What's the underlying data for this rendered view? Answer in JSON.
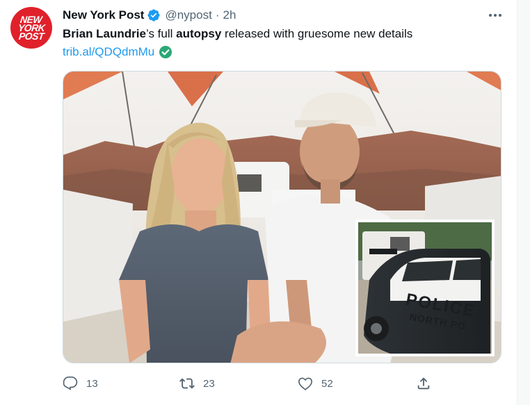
{
  "tweet": {
    "author_name": "New York Post",
    "handle": "@nypost",
    "separator": "·",
    "time": "2h",
    "avatar_lines": [
      "NEW",
      "YORK",
      "POST"
    ],
    "text_segments": [
      {
        "text": "Brian Laundrie",
        "bold": true
      },
      {
        "text": "’s full ",
        "bold": false
      },
      {
        "text": "autopsy",
        "bold": true
      },
      {
        "text": " released with gruesome new details",
        "bold": false
      }
    ],
    "link": "trib.al/QDQdmMu",
    "inset_sign_lines": [
      "POLICE",
      "NORTH PO"
    ],
    "replies": "13",
    "retweets": "23",
    "likes": "52"
  },
  "colors": {
    "accent": "#1d9bf0",
    "avatar_red": "#e0212b",
    "link_check_green": "#2aa876",
    "muted_text": "#536471"
  },
  "icons": [
    "verified-badge-icon",
    "more-options-icon",
    "link-check-icon",
    "reply-icon",
    "retweet-icon",
    "like-icon",
    "share-icon"
  ]
}
